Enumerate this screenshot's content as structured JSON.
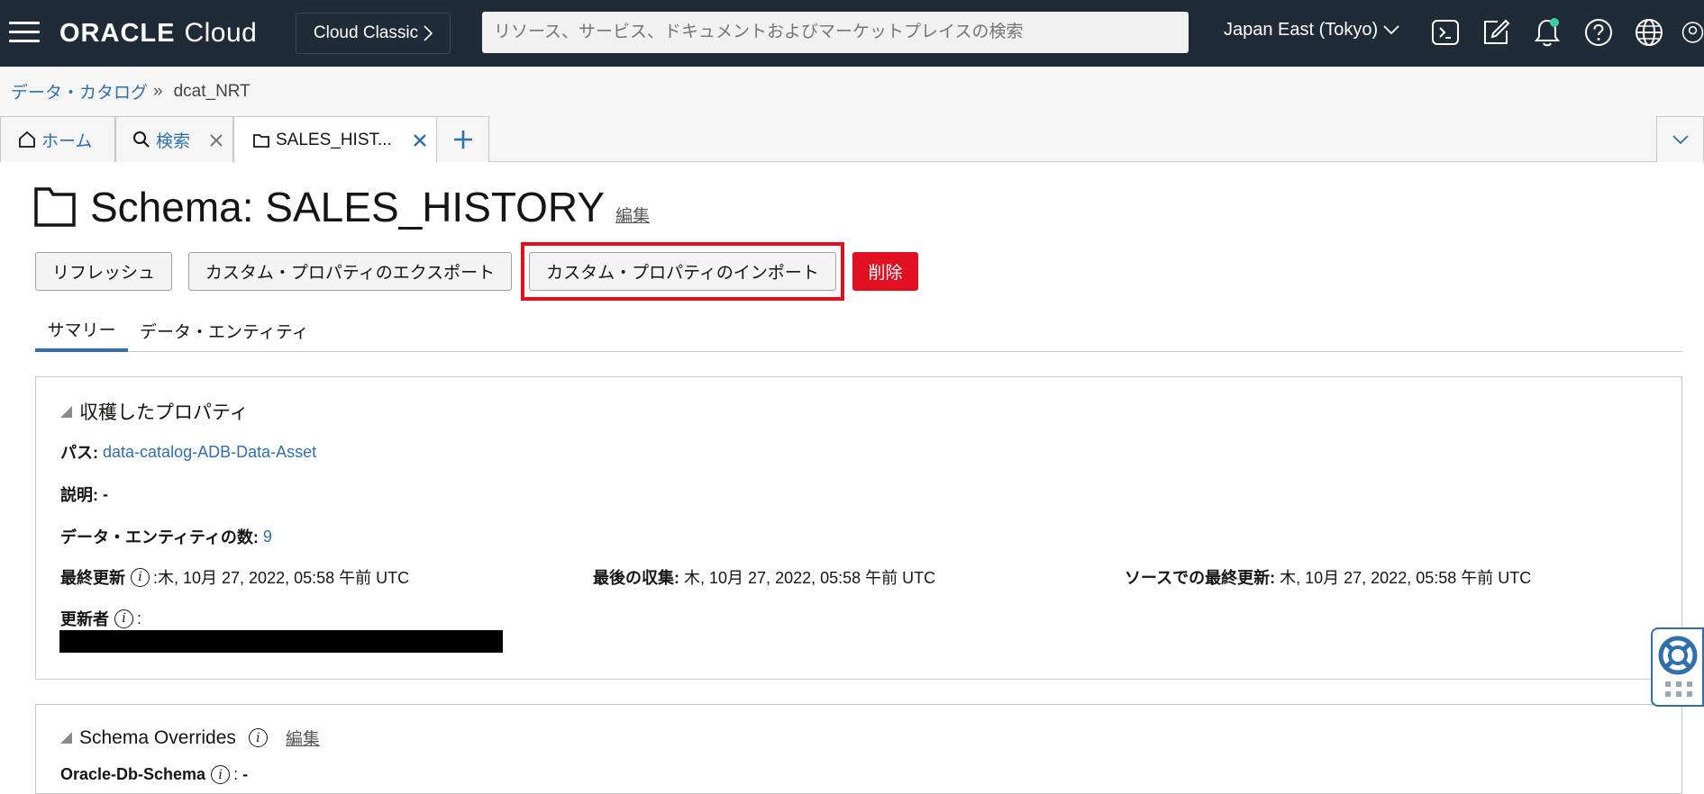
{
  "header": {
    "brand": "ORACLE",
    "product": "Cloud",
    "classic_label": "Cloud Classic",
    "search_placeholder": "リソース、サービス、ドキュメントおよびマーケットプレイスの検索",
    "region": "Japan East (Tokyo)",
    "icons": [
      "menu-icon",
      "cloud-shell-icon",
      "code-editor-icon",
      "notifications-icon",
      "help-icon",
      "language-icon",
      "profile-icon"
    ]
  },
  "breadcrumb": {
    "parent": "データ・カタログ",
    "separator": "»",
    "current": "dcat_NRT"
  },
  "tabs": [
    {
      "label": "ホーム",
      "icon": "home-icon"
    },
    {
      "label": "検索",
      "icon": "search-icon"
    },
    {
      "label": "SALES_HIST...",
      "icon": "folder-icon",
      "active": true
    }
  ],
  "page": {
    "title": "Schema: SALES_HISTORY",
    "edit_label": "編集"
  },
  "actions": {
    "refresh": "リフレッシュ",
    "export": "カスタム・プロパティのエクスポート",
    "import": "カスタム・プロパティのインポート",
    "delete": "削除"
  },
  "subtabs": {
    "summary": "サマリー",
    "entities": "データ・エンティティ"
  },
  "harvested": {
    "heading": "収穫したプロパティ",
    "path_label": "パス:",
    "path_value": "data-catalog-ADB-Data-Asset",
    "desc_label": "説明:",
    "desc_value": "-",
    "count_label": "データ・エンティティの数:",
    "count_value": "9",
    "updated_label": "最終更新",
    "updated_value": ":木, 10月 27, 2022, 05:58 午前 UTC",
    "collected_label": "最後の収集:",
    "collected_value": "木, 10月 27, 2022, 05:58 午前 UTC",
    "source_label": "ソースでの最終更新:",
    "source_value": "木, 10月 27, 2022, 05:58 午前 UTC",
    "updated_by_label": "更新者",
    "updated_by_sep": ":"
  },
  "overrides": {
    "heading": "Schema Overrides",
    "edit_label": "編集",
    "row_label": "Oracle-Db-Schema",
    "row_sep": ":",
    "row_value": "-"
  },
  "colors": {
    "header_bg": "#1f2b36",
    "link": "#2f6fad",
    "danger": "#e00f22",
    "highlight": "#e3101c"
  }
}
